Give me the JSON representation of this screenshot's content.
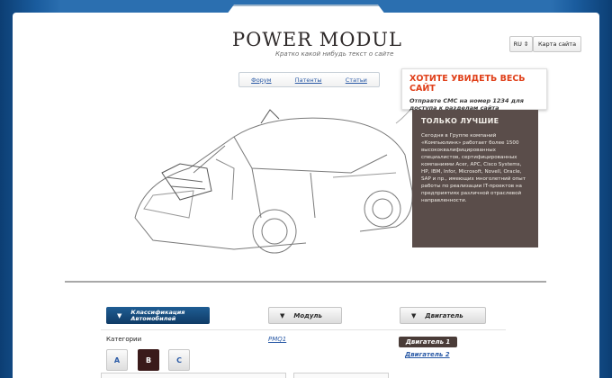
{
  "header": {
    "logo": "POWER MODUL",
    "tagline": "Кратко какой нибудь текст о сайте",
    "lang": "RU",
    "sitemap": "Карта сайта"
  },
  "nav": {
    "items": [
      "Форум",
      "Патенты",
      "Статьи"
    ]
  },
  "promo": {
    "title": "ХОТИТЕ УВИДЕТЬ ВЕСЬ САЙТ",
    "text": "Отправте СМС на номер 1234 для доступа к разделам сайта"
  },
  "info": {
    "title": "ТОЛЬКО ЛУЧШИЕ",
    "text": "Сегодня в Группе компаний «Компьюлинк» работает более 1500 высококвалифицированных специалистов, сертифицированных компаниями Acer, APC, Cisco Systems, HP, IBM, Infor, Microsoft, Novell, Oracle, SAP и пр., имеющих многолетний опыт работы по реализации IT-проектов на предприятиях различной отраслевой направленности."
  },
  "filters": {
    "classification_line1": "Классификация",
    "classification_line2": "Автомобилей",
    "module": "Модуль",
    "engine": "Двигатель"
  },
  "categories": {
    "label": "Категории",
    "buttons": [
      "A",
      "B",
      "C"
    ],
    "active": "B"
  },
  "modules": {
    "first": "PMQ1"
  },
  "engines": {
    "first": "Двигатель 1",
    "second": "Двигатель 2"
  },
  "colors": {
    "promo_title": "#e0401a",
    "info_bg": "#5a4d4a",
    "accent_blue": "#1f5d93",
    "link": "#2a5aa6"
  }
}
